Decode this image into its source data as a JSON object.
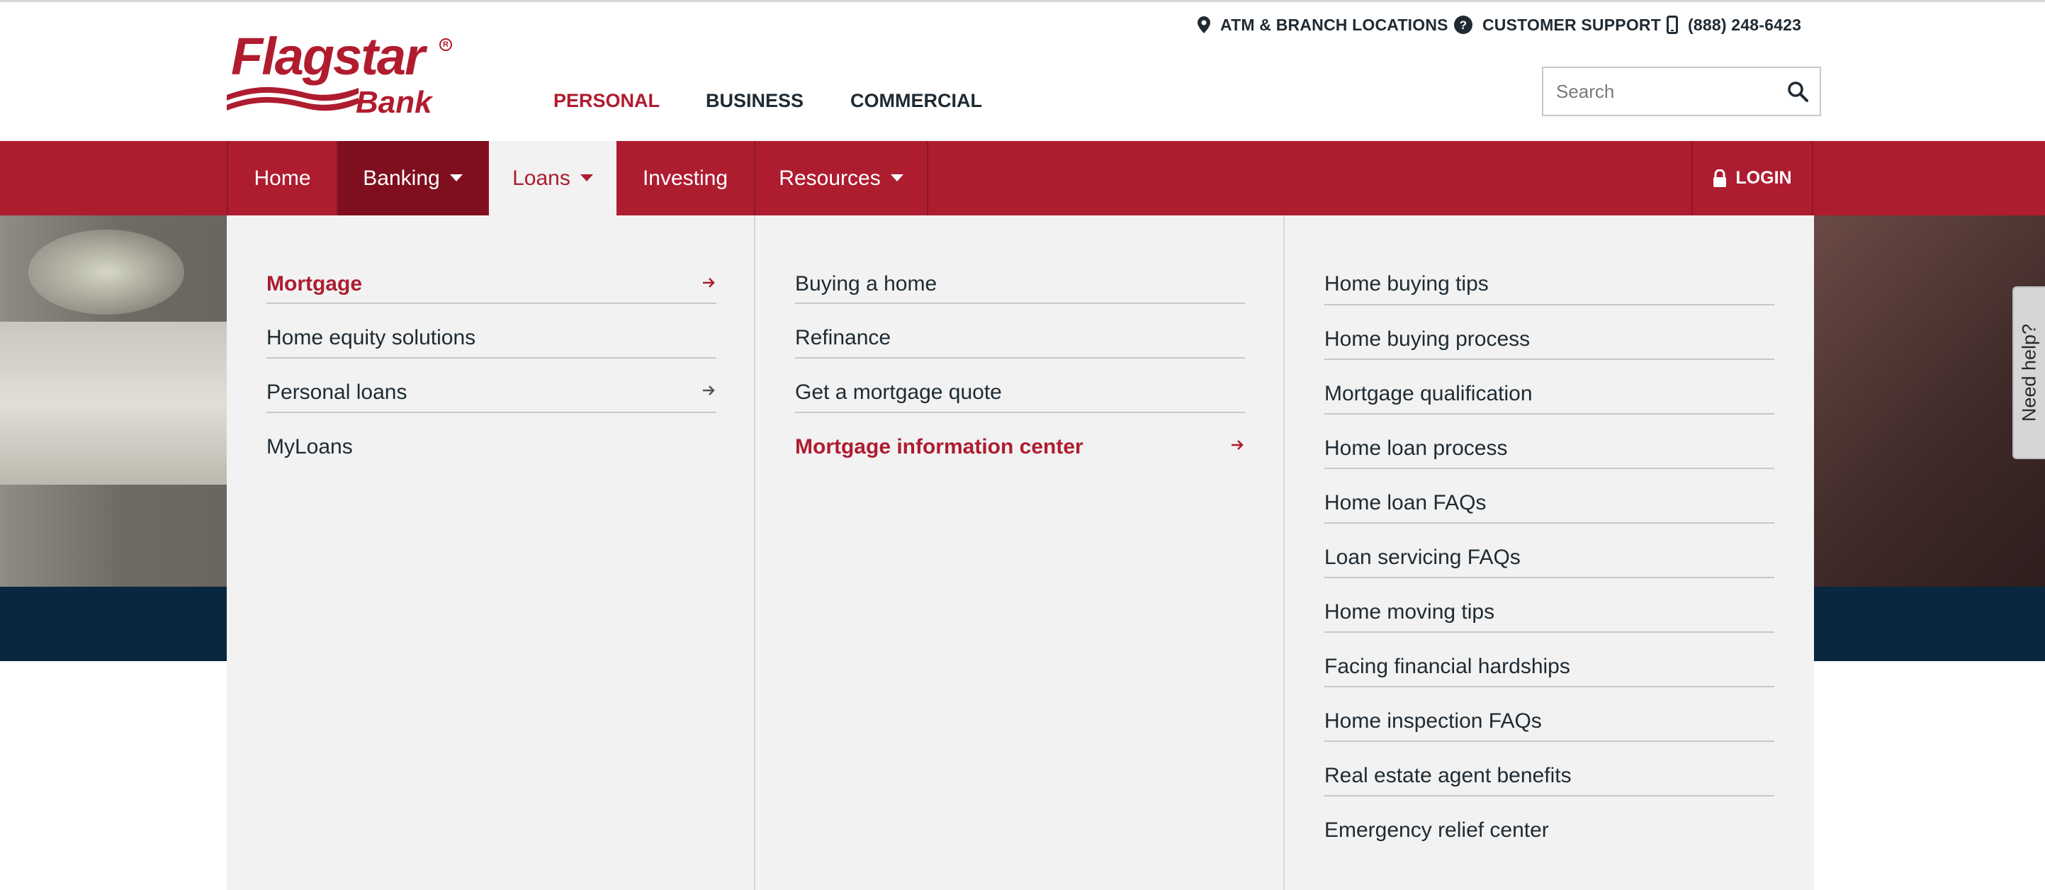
{
  "brand": {
    "name": "Flagstar",
    "sub": "Bank",
    "reg": "R",
    "color": "#ae1c30",
    "navy": "#092740"
  },
  "utility": {
    "atm_label": "ATM & BRANCH LOCATIONS",
    "support_label": "CUSTOMER SUPPORT",
    "phone_label": "(888) 248-6423"
  },
  "segments": {
    "personal": "PERSONAL",
    "business": "BUSINESS",
    "commercial": "COMMERCIAL",
    "active": "PERSONAL"
  },
  "search": {
    "placeholder": "Search"
  },
  "mainnav": {
    "home": "Home",
    "banking": "Banking",
    "loans": "Loans",
    "investing": "Investing",
    "resources": "Resources",
    "login": "LOGIN",
    "active": "Loans"
  },
  "mega": {
    "col1": [
      "Mortgage",
      "Home equity solutions",
      "Personal loans",
      "MyLoans"
    ],
    "col2": [
      "Buying a home",
      "Refinance",
      "Get a mortgage quote",
      "Mortgage information center"
    ],
    "col3": [
      "Home buying tips",
      "Home buying process",
      "Mortgage qualification",
      "Home loan process",
      "Home loan FAQs",
      "Loan servicing FAQs",
      "Home moving tips",
      "Facing financial hardships",
      "Home inspection FAQs",
      "Real estate agent benefits",
      "Emergency relief center"
    ],
    "highlighted": [
      "Mortgage",
      "Mortgage information center"
    ]
  },
  "help_tab": {
    "label": "Need help?"
  }
}
